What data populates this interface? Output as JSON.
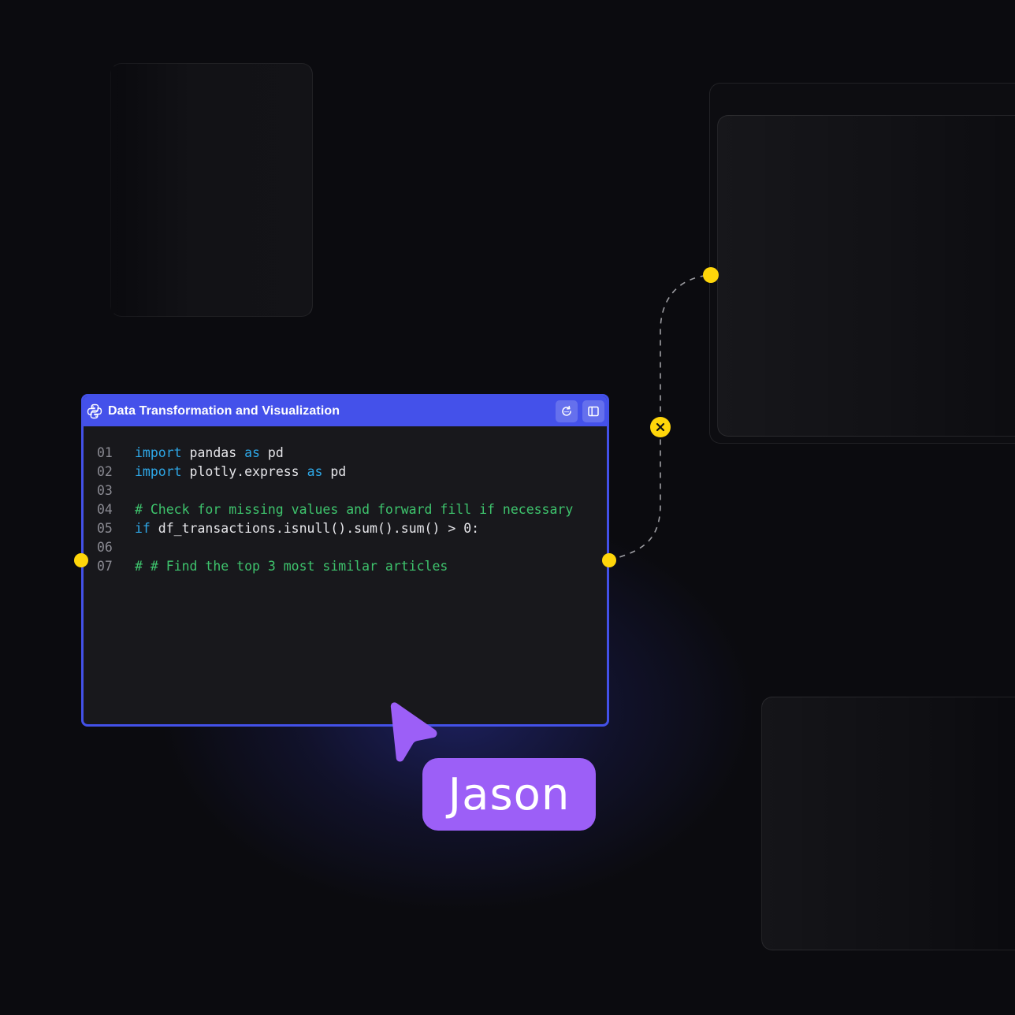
{
  "node": {
    "title": "Data Transformation and Visualization",
    "language_icon": "python-icon",
    "buttons": [
      {
        "name": "refresh-icon"
      },
      {
        "name": "panel-toggle-icon"
      }
    ],
    "code_lines": [
      {
        "num": "01",
        "tokens": [
          {
            "t": "import",
            "k": "kw"
          },
          {
            "t": " pandas ",
            "k": "tx"
          },
          {
            "t": "as",
            "k": "kw"
          },
          {
            "t": " pd",
            "k": "tx"
          }
        ]
      },
      {
        "num": "02",
        "tokens": [
          {
            "t": "import",
            "k": "kw"
          },
          {
            "t": " plotly.express ",
            "k": "tx"
          },
          {
            "t": "as",
            "k": "kw"
          },
          {
            "t": " pd",
            "k": "tx"
          }
        ]
      },
      {
        "num": "03",
        "tokens": []
      },
      {
        "num": "04",
        "tokens": [
          {
            "t": "# Check for missing values and forward fill if necessary",
            "k": "cm"
          }
        ]
      },
      {
        "num": "05",
        "tokens": [
          {
            "t": "if",
            "k": "kw"
          },
          {
            "t": " df_transactions.isnull().sum().sum() > 0:",
            "k": "tx"
          }
        ]
      },
      {
        "num": "06",
        "tokens": []
      },
      {
        "num": "07",
        "tokens": [
          {
            "t": "# # Find the top 3 most similar articles",
            "k": "cm"
          }
        ]
      }
    ]
  },
  "collaborator": {
    "name": "Jason",
    "color": "#9c5ff7"
  },
  "colors": {
    "background": "#0b0b0f",
    "node_accent": "#4451ea",
    "port": "#ffd60a",
    "keyword": "#2ea8e8",
    "comment": "#3ec46d"
  }
}
